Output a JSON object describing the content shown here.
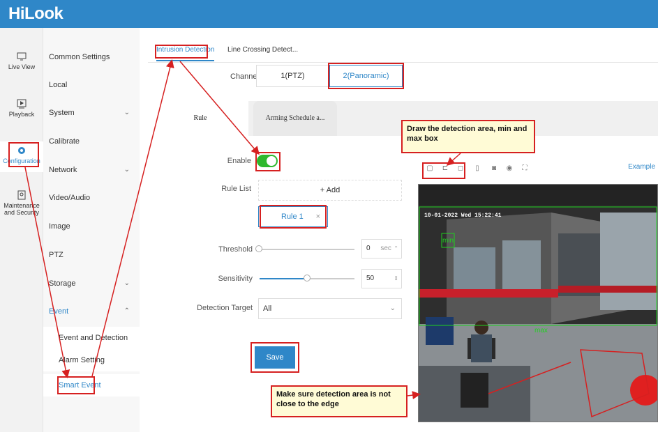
{
  "app": {
    "logo": "HiLook"
  },
  "rail": [
    {
      "label": "Live View",
      "icon": "monitor-icon"
    },
    {
      "label": "Playback",
      "icon": "play-icon"
    },
    {
      "label": "Configuration",
      "icon": "gear-icon"
    },
    {
      "label": "Maintenance and Security",
      "icon": "shield-icon"
    }
  ],
  "menu": {
    "common_settings": "Common Settings",
    "local": "Local",
    "system": "System",
    "calibrate": "Calibrate",
    "network": "Network",
    "video_audio": "Video/Audio",
    "image": "Image",
    "ptz": "PTZ",
    "storage": "Storage",
    "event": "Event",
    "event_and_detection": "Event and Detection",
    "alarm_setting": "Alarm Setting",
    "smart_event": "Smart Event",
    "chevron_down": "⌄",
    "chevron_up": "⌃"
  },
  "tabs": {
    "intrusion": "Intrusion Detection",
    "line_crossing": "Line Crossing Detect..."
  },
  "channel": {
    "label": "Channel",
    "options": [
      "1(PTZ)",
      "2(Panoramic)"
    ]
  },
  "subtabs": {
    "rule": "Rule",
    "arming": "Arming Schedule a..."
  },
  "form": {
    "enable_label": "Enable",
    "rule_list_label": "Rule List",
    "add_label": "+ Add",
    "rule_chip": "Rule 1",
    "rule_chip_close": "×",
    "threshold_label": "Threshold",
    "threshold_value": "0",
    "threshold_unit": "sec",
    "sensitivity_label": "Sensitivity",
    "sensitivity_value": "50",
    "detection_target_label": "Detection Target",
    "detection_target_value": "All",
    "save_label": "Save"
  },
  "video": {
    "example_link": "Example",
    "timestamp": "10-01-2022 Wed 15:22:41",
    "min_label": "min",
    "max_label": "max",
    "sensitivity_level": 0.5
  },
  "annotations": {
    "draw_area": "Draw the detection area, min and max box",
    "edge_note": "Make sure detection area is not close to the edge"
  },
  "colors": {
    "header": "#2f87c8",
    "accent": "#2f87c8",
    "annotation_red": "#d62020",
    "toggle_on": "#2eb82e"
  }
}
